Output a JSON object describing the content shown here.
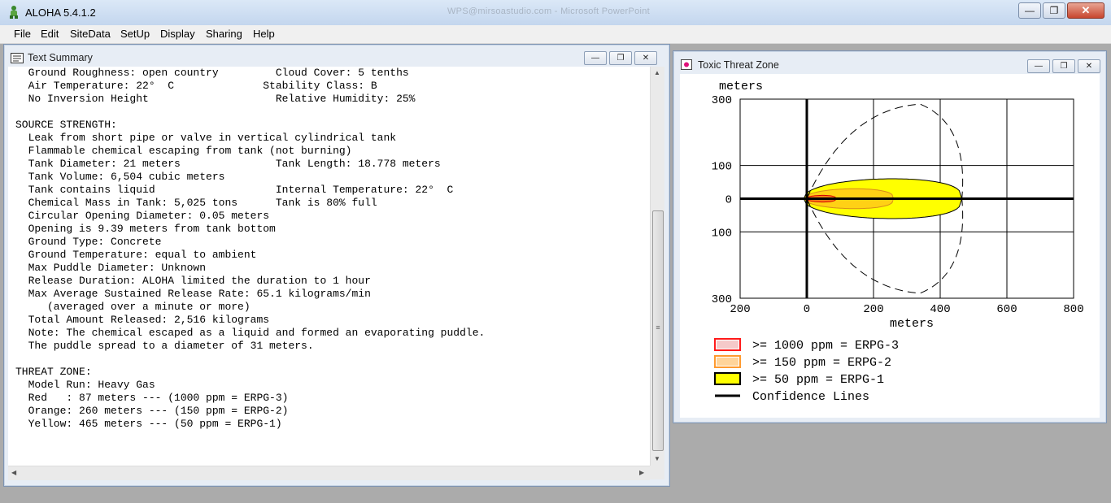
{
  "app": {
    "title": "ALOHA 5.4.1.2",
    "background_title": "WPS@mirsoastudio.com - Microsoft PowerPoint",
    "menu": [
      "File",
      "Edit",
      "SiteData",
      "SetUp",
      "Display",
      "Sharing",
      "Help"
    ]
  },
  "text_summary": {
    "title": "Text Summary",
    "lines": [
      "  Ground Roughness: open country         Cloud Cover: 5 tenths",
      "  Air Temperature: 22°  C              Stability Class: B",
      "  No Inversion Height                    Relative Humidity: 25%",
      "",
      "SOURCE STRENGTH:",
      "  Leak from short pipe or valve in vertical cylindrical tank",
      "  Flammable chemical escaping from tank (not burning)",
      "  Tank Diameter: 21 meters               Tank Length: 18.778 meters",
      "  Tank Volume: 6,504 cubic meters",
      "  Tank contains liquid                   Internal Temperature: 22°  C",
      "  Chemical Mass in Tank: 5,025 tons      Tank is 80% full",
      "  Circular Opening Diameter: 0.05 meters",
      "  Opening is 9.39 meters from tank bottom",
      "  Ground Type: Concrete",
      "  Ground Temperature: equal to ambient",
      "  Max Puddle Diameter: Unknown",
      "  Release Duration: ALOHA limited the duration to 1 hour",
      "  Max Average Sustained Release Rate: 65.1 kilograms/min",
      "     (averaged over a minute or more)",
      "  Total Amount Released: 2,516 kilograms",
      "  Note: The chemical escaped as a liquid and formed an evaporating puddle.",
      "  The puddle spread to a diameter of 31 meters.",
      "",
      "THREAT ZONE:",
      "  Model Run: Heavy Gas",
      "  Red   : 87 meters --- (1000 ppm = ERPG-3)",
      "  Orange: 260 meters --- (150 ppm = ERPG-2)",
      "  Yellow: 465 meters --- (50 ppm = ERPG-1)"
    ]
  },
  "threat_zone": {
    "title": "Toxic Threat Zone",
    "y_axis_label": "meters",
    "x_axis_label": "meters",
    "y_tick_labels": [
      "300",
      "100",
      "0",
      "100",
      "300"
    ],
    "x_tick_labels": [
      "200",
      "0",
      "200",
      "400",
      "600",
      "800"
    ],
    "legend": [
      {
        "label": ">= 1000 ppm = ERPG-3",
        "color": "#ff1a1a"
      },
      {
        "label": ">= 150 ppm = ERPG-2",
        "color": "#ff9a2e"
      },
      {
        "label": ">= 50 ppm = ERPG-1",
        "color": "#ffff00"
      },
      {
        "label": "Confidence Lines",
        "color": "#000000"
      }
    ]
  },
  "chart_data": {
    "type": "area",
    "title": "Toxic Threat Zone",
    "xlabel": "meters",
    "ylabel": "meters",
    "xlim": [
      -200,
      800
    ],
    "ylim": [
      -300,
      300
    ],
    "x_ticks": [
      -200,
      0,
      200,
      400,
      600,
      800
    ],
    "y_ticks": [
      -300,
      -100,
      0,
      100,
      300
    ],
    "grid": true,
    "series": [
      {
        "name": ">= 50 ppm = ERPG-1",
        "color": "#ffff00",
        "downwind_extent_m": 465,
        "max_half_width_m": 60
      },
      {
        "name": ">= 150 ppm = ERPG-2",
        "color": "#ff9a2e",
        "downwind_extent_m": 260,
        "max_half_width_m": 30
      },
      {
        "name": ">= 1000 ppm = ERPG-3",
        "color": "#ff1a1a",
        "downwind_extent_m": 87,
        "max_half_width_m": 10
      },
      {
        "name": "Confidence Lines",
        "color": "#000000",
        "downwind_extent_m": 465,
        "max_half_width_m": 300
      }
    ]
  }
}
